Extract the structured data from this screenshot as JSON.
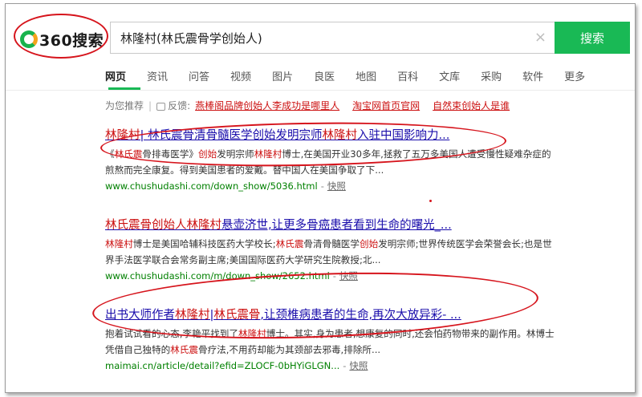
{
  "logo": {
    "text": "360搜索"
  },
  "search": {
    "query": "林隆村(林氏震骨学创始人)",
    "clear_symbol": "×",
    "button_label": "搜索"
  },
  "nav": {
    "tabs": [
      "网页",
      "资讯",
      "问答",
      "视频",
      "图片",
      "良医",
      "地图",
      "百科",
      "文库",
      "采购",
      "软件",
      "更多"
    ],
    "active_index": 0
  },
  "recommend": {
    "label": "为您推荐",
    "separator": "|",
    "feedback_label": "反馈:",
    "links": [
      "燕棒阁品牌创始人李成功是哪里人",
      "淘宝网首页官网",
      "自然束创始人是谁"
    ]
  },
  "results": [
    {
      "title_parts": [
        "林隆村",
        "| 林氏震骨清骨髓医学创始发明宗师",
        "林隆村",
        "入驻中国影响力..."
      ],
      "desc_parts": [
        "《",
        "林氏震",
        "骨排毒医学》",
        "创始",
        "发明宗师",
        "林隆村",
        "博士,在美国开业30多年,拯救了五万多美国人遭受慢性疑难杂症的煎熬而完全康复。得到美国患者的爱戴。替中国人在美国争取了下..."
      ],
      "url": "www.chushudashi.com/down_show/5036.html",
      "dot": "-",
      "snapshot": "快照"
    },
    {
      "title_parts": [
        "林氏震骨创始人林隆村",
        "悬壶济世,让更多骨癌患者看到生命的曙光_..."
      ],
      "desc_parts": [
        "林隆村",
        "博士是美国哈辅科技医药大学校长;",
        "林氏震",
        "骨清骨髓医学",
        "创始",
        "发明宗师;世界传统医学会荣誉会长;也是世界手法医学联合会常务副主席;美国国际医药大学研究生院教授;北..."
      ],
      "url": "www.chushudashi.com/m/down_show/2652.html",
      "dot": "-",
      "snapshot": "快照"
    },
    {
      "title_parts": [
        "出书大师作者",
        "林隆村",
        "|",
        "林氏震骨",
        ",让颈椎病患者的生命,再次大放异彩- ..."
      ],
      "desc_parts": [
        "抱着试试看的心态,李艳平找到了",
        "林隆村",
        "博士。其实,身为患者,想康复的同时,还会怕药物带来的副作用。林博士凭借自己独特的",
        "林氏震",
        "骨疗法,不用药却能为其颈部去邪毒,排除所..."
      ],
      "url": "maimai.cn/article/detail?efid=ZLOCF-0bHYiGLGN...",
      "dot": "-",
      "snapshot": "快照"
    }
  ],
  "colors": {
    "accent_green": "#19b955",
    "link_blue": "#1a0dab",
    "highlight_red": "#cc1111",
    "url_green": "#008000",
    "annotation_red": "#d6141c"
  }
}
